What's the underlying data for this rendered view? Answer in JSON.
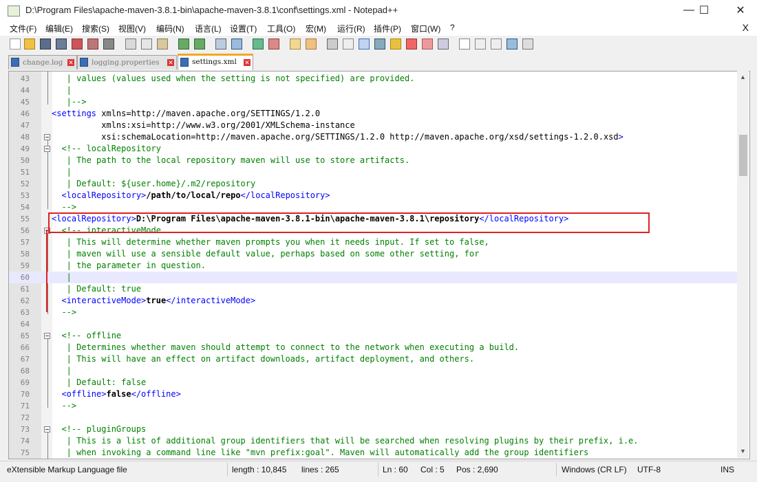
{
  "window": {
    "title": "D:\\Program Files\\apache-maven-3.8.1-bin\\apache-maven-3.8.1\\conf\\settings.xml - Notepad++",
    "minimize": "—",
    "maximize": "☐",
    "close": "✕"
  },
  "menu": [
    "文件(F)",
    "编辑(E)",
    "搜索(S)",
    "视图(V)",
    "编码(N)",
    "语言(L)",
    "设置(T)",
    "工具(O)",
    "宏(M)",
    "运行(R)",
    "插件(P)",
    "窗口(W)",
    "?"
  ],
  "menu_close": "X",
  "tabs": [
    {
      "label": "change.log"
    },
    {
      "label": "logging.properties"
    },
    {
      "label": "settings.xml"
    }
  ],
  "tab_close": "✕",
  "editor": {
    "lines": [
      {
        "n": "43",
        "text": "   | values (values used when the setting is not specified) are provided."
      },
      {
        "n": "44",
        "text": "   |"
      },
      {
        "n": "45",
        "text": "   |-->"
      },
      {
        "n": "46",
        "text": "<settings xmlns=\"http://maven.apache.org/SETTINGS/1.2.0\""
      },
      {
        "n": "47",
        "text": "          xmlns:xsi=\"http://www.w3.org/2001/XMLSchema-instance\""
      },
      {
        "n": "48",
        "text": "          xsi:schemaLocation=\"http://maven.apache.org/SETTINGS/1.2.0 http://maven.apache.org/xsd/settings-1.2.0.xsd\">"
      },
      {
        "n": "49",
        "text": "  <!-- localRepository"
      },
      {
        "n": "50",
        "text": "   | The path to the local repository maven will use to store artifacts."
      },
      {
        "n": "51",
        "text": "   |"
      },
      {
        "n": "52",
        "text": "   | Default: ${user.home}/.m2/repository"
      },
      {
        "n": "53",
        "text": "  <localRepository>/path/to/local/repo</localRepository>"
      },
      {
        "n": "54",
        "text": "  -->"
      },
      {
        "n": "55",
        "text": "<localRepository>D:\\Program Files\\apache-maven-3.8.1-bin\\apache-maven-3.8.1\\repository</localRepository>"
      },
      {
        "n": "56",
        "text": "  <!-- interactiveMode"
      },
      {
        "n": "57",
        "text": "   | This will determine whether maven prompts you when it needs input. If set to false,"
      },
      {
        "n": "58",
        "text": "   | maven will use a sensible default value, perhaps based on some other setting, for"
      },
      {
        "n": "59",
        "text": "   | the parameter in question."
      },
      {
        "n": "60",
        "text": "   |"
      },
      {
        "n": "61",
        "text": "   | Default: true"
      },
      {
        "n": "62",
        "text": "  <interactiveMode>true</interactiveMode>"
      },
      {
        "n": "63",
        "text": "  -->"
      },
      {
        "n": "64",
        "text": ""
      },
      {
        "n": "65",
        "text": "  <!-- offline"
      },
      {
        "n": "66",
        "text": "   | Determines whether maven should attempt to connect to the network when executing a build."
      },
      {
        "n": "67",
        "text": "   | This will have an effect on artifact downloads, artifact deployment, and others."
      },
      {
        "n": "68",
        "text": "   |"
      },
      {
        "n": "69",
        "text": "   | Default: false"
      },
      {
        "n": "70",
        "text": "  <offline>false</offline>"
      },
      {
        "n": "71",
        "text": "  -->"
      },
      {
        "n": "72",
        "text": ""
      },
      {
        "n": "73",
        "text": "  <!-- pluginGroups"
      },
      {
        "n": "74",
        "text": "   | This is a list of additional group identifiers that will be searched when resolving plugins by their prefix, i.e."
      },
      {
        "n": "75",
        "text": "   | when invoking a command line like \"mvn prefix:goal\". Maven will automatically add the group identifiers"
      }
    ]
  },
  "status": {
    "language": "eXtensible Markup Language file",
    "length": "length : 10,845",
    "lines": "lines : 265",
    "ln": "Ln : 60",
    "col": "Col : 5",
    "pos": "Pos : 2,690",
    "eol": "Windows (CR LF)",
    "encoding": "UTF-8",
    "mode": "INS"
  }
}
